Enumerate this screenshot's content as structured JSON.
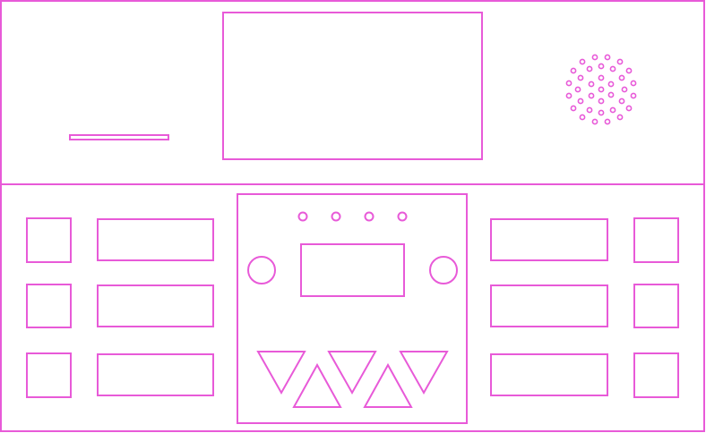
{
  "colors": {
    "line": "#e85ad8",
    "background": "#ffffff"
  },
  "device": {
    "top_panel": {
      "screen": {},
      "card_slot": {},
      "speaker_grille": {}
    },
    "bottom_panel": {
      "left_pads": {
        "count": 3
      },
      "left_labels": {
        "count": 3
      },
      "right_labels": {
        "count": 3
      },
      "right_pads": {
        "count": 3
      },
      "center_module": {
        "indicator_leds": {
          "count": 4
        },
        "knobs": {
          "count": 2
        },
        "mini_display": {},
        "triangle_keys": {
          "down": 3,
          "up": 2
        }
      }
    }
  }
}
